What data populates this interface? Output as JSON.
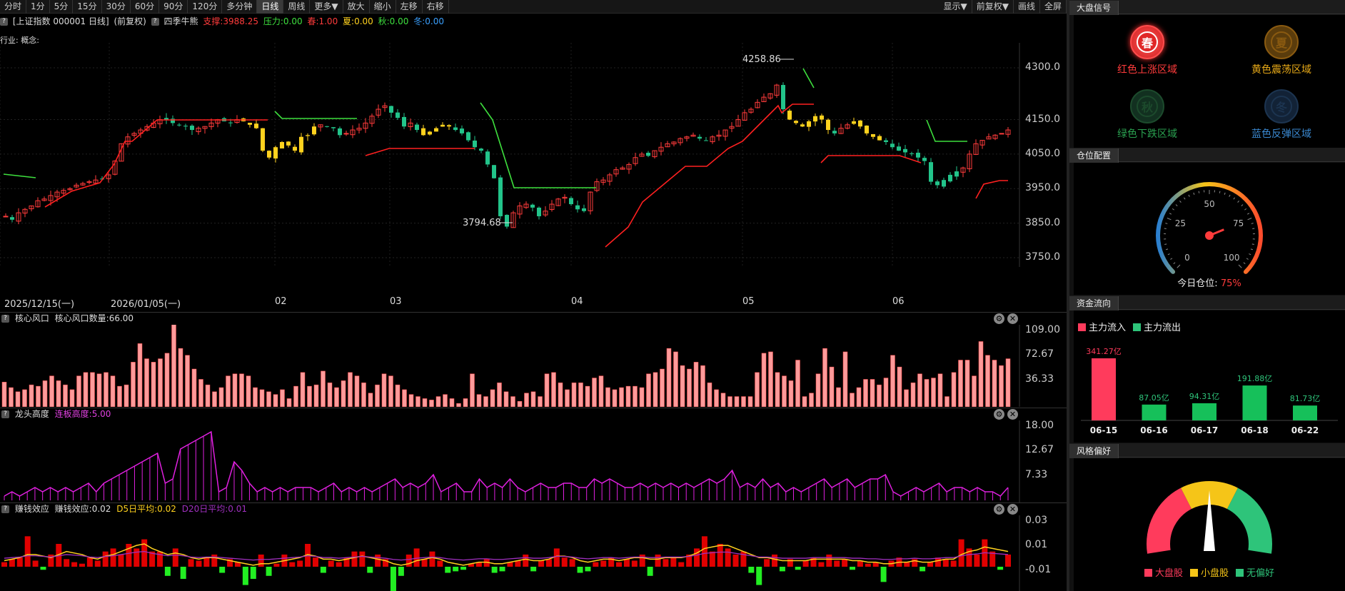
{
  "toolbar": {
    "left": [
      "分时",
      "1分",
      "5分",
      "15分",
      "30分",
      "60分",
      "90分",
      "120分",
      "多分钟",
      "日线",
      "周线",
      "更多▼",
      "放大",
      "缩小",
      "左移",
      "右移"
    ],
    "active": "日线",
    "right": [
      "显示▼",
      "前复权▼",
      "画线",
      "全屏"
    ]
  },
  "info": {
    "q": "?",
    "title": "[上证指数 000001 日线]",
    "adj": "(前复权)",
    "indicator": "四季牛熊",
    "support": "支撑:3988.25",
    "pressure": "压力:0.00",
    "spring": "春:1.00",
    "summer": "夏:0.00",
    "autumn": "秋:0.00",
    "winter": "冬:0.00",
    "colors": {
      "support": "#ff3b3b",
      "pressure": "#3ee03e",
      "spring": "#ff3b3b",
      "summer": "#ffd21e",
      "autumn": "#3ee03e",
      "winter": "#3aa0ff"
    }
  },
  "industry": "行业: 概念:",
  "main": {
    "y_labels": [
      "4300.0",
      "4150.0",
      "4050.0",
      "3950.0",
      "3850.0",
      "3750.0"
    ],
    "y_values": [
      4300,
      4150,
      4050,
      3950,
      3850,
      3750
    ],
    "high_label": "4258.86",
    "low_label": "3794.68",
    "dates": [
      "2025/12/15(一)",
      "2026/01/05(一)",
      "02",
      "03",
      "04",
      "05",
      "06"
    ]
  },
  "core": {
    "q": "?",
    "title": "核心风口",
    "text": "核心风口数量:66.00",
    "y_labels": [
      "109.00",
      "72.67",
      "36.33"
    ],
    "values": [
      36,
      28,
      22,
      25,
      32,
      30,
      38,
      45,
      38,
      32,
      25,
      45,
      50,
      50,
      48,
      50,
      45,
      30,
      32,
      65,
      92,
      70,
      65,
      70,
      78,
      125,
      85,
      75,
      55,
      40,
      32,
      22,
      28,
      45,
      48,
      48,
      45,
      28,
      25,
      22,
      18,
      25,
      12,
      30,
      50,
      30,
      32,
      52,
      35,
      28,
      38,
      50,
      45,
      35,
      20,
      32,
      48,
      45,
      32,
      25,
      18,
      15,
      12,
      10,
      15,
      18,
      12,
      5,
      12,
      48,
      18,
      15,
      25,
      35,
      22,
      15,
      8,
      20,
      22,
      15,
      48,
      50,
      35,
      25,
      35,
      35,
      30,
      42,
      45,
      28,
      25,
      28,
      30,
      30,
      28,
      48,
      50,
      55,
      85,
      80,
      60,
      55,
      65,
      60,
      35,
      25,
      20,
      15,
      15,
      15,
      15,
      50,
      78,
      80,
      50,
      45,
      38,
      68,
      15,
      20,
      48,
      85,
      58,
      28,
      80,
      20,
      28,
      40,
      40,
      32,
      42,
      75,
      58,
      25,
      35,
      48,
      40,
      42,
      48,
      15,
      50,
      68,
      68,
      45,
      95,
      75,
      68,
      60,
      70
    ],
    "max": 109
  },
  "dragon": {
    "q": "?",
    "title": "龙头高度",
    "text": "连板高度:5.00",
    "y_labels": [
      "18.00",
      "12.67",
      "7.33"
    ],
    "peaks": [
      1,
      2,
      1,
      2,
      3,
      2,
      3,
      2,
      3,
      2,
      3,
      4,
      2,
      4,
      5,
      6,
      7,
      8,
      9,
      10,
      11,
      4,
      5,
      12,
      13,
      14,
      15,
      16,
      2,
      3,
      9,
      7,
      4,
      2,
      3,
      2,
      3,
      2,
      3,
      3,
      3,
      2,
      3,
      4,
      2,
      3,
      2,
      3,
      2,
      3,
      4,
      5,
      3,
      4,
      3,
      4,
      6,
      2,
      3,
      4,
      2,
      2,
      5,
      3,
      4,
      3,
      5,
      3,
      2,
      3,
      4,
      3,
      3,
      4,
      4,
      3,
      3,
      5,
      4,
      5,
      4,
      3,
      3,
      4,
      3,
      4,
      3,
      4,
      3,
      4,
      3,
      4,
      5,
      4,
      5,
      7,
      3,
      4,
      3,
      5,
      3,
      4,
      2,
      3,
      2,
      3,
      4,
      5,
      3,
      4,
      5,
      3,
      4,
      5,
      5,
      6,
      2,
      1,
      2,
      3,
      2,
      3,
      4,
      2,
      3,
      3,
      2,
      3,
      2,
      2,
      1,
      3
    ],
    "max": 18
  },
  "money": {
    "q": "?",
    "title": "赚钱效应",
    "text": "赚钱效应:0.02",
    "d5": "D5日平均:0.02",
    "d20": "D20日平均:0.01",
    "y_labels": [
      "0.03",
      "0.01",
      "-0.01"
    ],
    "bars": [
      0.003,
      0.005,
      0.006,
      0.02,
      0.004,
      -0.002,
      0.008,
      0.015,
      0.005,
      0.003,
      0.002,
      0.006,
      0.004,
      0.01,
      0.012,
      0.008,
      0.015,
      0.012,
      0.018,
      0.01,
      0.01,
      -0.006,
      0.012,
      -0.008,
      0.005,
      0.004,
      0.006,
      0.008,
      -0.004,
      0.005,
      0.003,
      -0.012,
      -0.008,
      0.008,
      -0.006,
      0.002,
      0.008,
      0.003,
      0.004,
      0.015,
      0.006,
      -0.004,
      0.004,
      0.003,
      0.006,
      0.01,
      0.01,
      -0.004,
      0.008,
      0.005,
      -0.02,
      -0.006,
      0.008,
      0.012,
      0.005,
      0.01,
      0.004,
      -0.004,
      -0.003,
      -0.002,
      0.002,
      0.003,
      0.005,
      -0.004,
      -0.003,
      0.003,
      0.004,
      0.008,
      -0.003,
      0.004,
      0.005,
      0.012,
      0.006,
      0.005,
      -0.004,
      -0.003,
      0.003,
      0.004,
      0.006,
      0.003,
      0.005,
      0.004,
      0.008,
      -0.006,
      0.008,
      0.005,
      0.006,
      0.003,
      0.008,
      0.012,
      0.02,
      0.01,
      0.015,
      0.012,
      0.008,
      0.01,
      -0.004,
      -0.012,
      0.005,
      0.008,
      -0.003,
      0.005,
      -0.002,
      0.004,
      0.006,
      0.003,
      0.008,
      0.004,
      0.005,
      -0.002,
      0.004,
      0.002,
      0.003,
      -0.01,
      0.004,
      0.006,
      0.003,
      0.005,
      -0.003,
      0.003,
      0.006,
      0.005,
      0.004,
      0.018,
      0.012,
      0.008,
      0.018,
      0.01,
      -0.002,
      0.008
    ],
    "line1": [
      0.004,
      0.005,
      0.006,
      0.008,
      0.008,
      0.007,
      0.006,
      0.008,
      0.01,
      0.009,
      0.008,
      0.006,
      0.005,
      0.007,
      0.008,
      0.01,
      0.012,
      0.014,
      0.015,
      0.012,
      0.01,
      0.008,
      0.009,
      0.008,
      0.006,
      0.005,
      0.006,
      0.006,
      0.005,
      0.004,
      0.003,
      0.002,
      0.001,
      0.002,
      0.002,
      0.003,
      0.004,
      0.005,
      0.006,
      0.008,
      0.007,
      0.005,
      0.005,
      0.004,
      0.005,
      0.006,
      0.007,
      0.006,
      0.005,
      0.004,
      0.002,
      0.001,
      0.002,
      0.004,
      0.005,
      0.006,
      0.005,
      0.003,
      0.002,
      0.001,
      0.002,
      0.003,
      0.003,
      0.002,
      0.002,
      0.003,
      0.004,
      0.005,
      0.004,
      0.004,
      0.005,
      0.007,
      0.007,
      0.006,
      0.004,
      0.003,
      0.004,
      0.005,
      0.005,
      0.004,
      0.005,
      0.006,
      0.006,
      0.005,
      0.005,
      0.006,
      0.006,
      0.006,
      0.007,
      0.009,
      0.012,
      0.013,
      0.014,
      0.014,
      0.012,
      0.01,
      0.008,
      0.006,
      0.006,
      0.005,
      0.004,
      0.004,
      0.004,
      0.004,
      0.005,
      0.005,
      0.005,
      0.005,
      0.005,
      0.004,
      0.004,
      0.003,
      0.003,
      0.002,
      0.002,
      0.003,
      0.003,
      0.004,
      0.003,
      0.003,
      0.004,
      0.005,
      0.005,
      0.008,
      0.01,
      0.011,
      0.013,
      0.012,
      0.011,
      0.01
    ],
    "max": 0.03,
    "min": -0.015
  },
  "right": {
    "signal": {
      "title": "大盘信号",
      "items": [
        {
          "char": "春",
          "label": "红色上涨区域",
          "color": "#ff3b3b",
          "ring": "#ff4d4d",
          "fill": "#e12a2a",
          "active": true
        },
        {
          "char": "夏",
          "label": "黄色震荡区域",
          "color": "#e6a817",
          "ring": "#8a5a10",
          "fill": "#5a3c0c",
          "active": false
        },
        {
          "char": "秋",
          "label": "绿色下跌区域",
          "color": "#2aa050",
          "ring": "#1c4a2c",
          "fill": "#123020",
          "active": false
        },
        {
          "char": "冬",
          "label": "蓝色反弹区域",
          "color": "#3a88d0",
          "ring": "#1c3450",
          "fill": "#122236",
          "active": false
        }
      ]
    },
    "position": {
      "title": "仓位配置",
      "ticks": [
        "0",
        "25",
        "50",
        "75",
        "100"
      ],
      "today_label": "今日仓位:",
      "today_value": "75%",
      "value": 75
    },
    "flow": {
      "title": "资金流向",
      "legend_in": "主力流入",
      "legend_out": "主力流出",
      "bars": [
        {
          "date": "06-15",
          "value": 341.27,
          "label": "341.27亿",
          "dir": "in"
        },
        {
          "date": "06-16",
          "value": 87.05,
          "label": "87.05亿",
          "dir": "out"
        },
        {
          "date": "06-17",
          "value": 94.31,
          "label": "94.31亿",
          "dir": "out"
        },
        {
          "date": "06-18",
          "value": 191.88,
          "label": "191.88亿",
          "dir": "out"
        },
        {
          "date": "06-22",
          "value": 81.73,
          "label": "81.73亿",
          "dir": "out"
        }
      ]
    },
    "style": {
      "title": "风格偏好",
      "legend": [
        {
          "label": "大盘股",
          "color": "#ff3b5c"
        },
        {
          "label": "小盘股",
          "color": "#f5c518"
        },
        {
          "label": "无偏好",
          "color": "#2ec47a"
        }
      ]
    }
  }
}
